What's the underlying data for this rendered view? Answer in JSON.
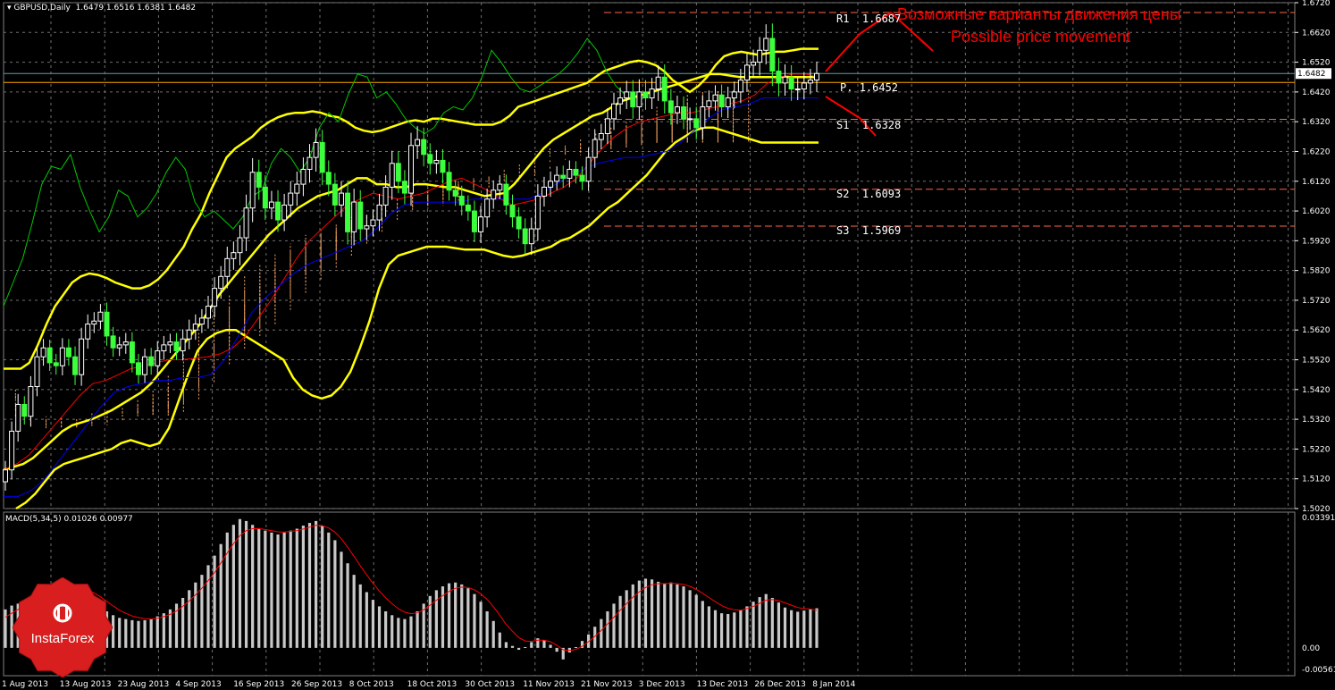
{
  "header": {
    "symbol": "GBPUSD,Daily",
    "ohlc": "1.6479 1.6516 1.6381 1.6482"
  },
  "chart_data": [
    {
      "type": "candlestick",
      "title": "GBPUSD,Daily",
      "ylim": [
        1.502,
        1.672
      ],
      "y_ticks": [
        "1.6720",
        "1.6620",
        "1.6520",
        "1.6420",
        "1.6320",
        "1.6220",
        "1.6120",
        "1.6020",
        "1.5920",
        "1.5820",
        "1.5720",
        "1.5620",
        "1.5520",
        "1.5420",
        "1.5320",
        "1.5220",
        "1.5120",
        "1.5020"
      ],
      "x_labels": [
        "1 Aug 2013",
        "13 Aug 2013",
        "23 Aug 2013",
        "4 Sep 2013",
        "16 Sep 2013",
        "26 Sep 2013",
        "8 Oct 2013",
        "18 Oct 2013",
        "30 Oct 2013",
        "11 Nov 2013",
        "21 Nov 2013",
        "3 Dec 2013",
        "13 Dec 2013",
        "26 Dec 2013",
        "8 Jan 2014"
      ],
      "last_price_label": "1.6482",
      "close": [
        1.515,
        1.528,
        1.537,
        1.533,
        1.543,
        1.553,
        1.556,
        1.551,
        1.55,
        1.556,
        1.553,
        1.547,
        1.559,
        1.564,
        1.565,
        1.568,
        1.56,
        1.556,
        1.557,
        1.558,
        1.551,
        1.547,
        1.553,
        1.55,
        1.555,
        1.557,
        1.558,
        1.555,
        1.559,
        1.562,
        1.564,
        1.566,
        1.57,
        1.576,
        1.58,
        1.586,
        1.588,
        1.593,
        1.603,
        1.615,
        1.61,
        1.603,
        1.605,
        1.599,
        1.604,
        1.608,
        1.611,
        1.616,
        1.62,
        1.625,
        1.615,
        1.611,
        1.604,
        1.608,
        1.595,
        1.605,
        1.596,
        1.597,
        1.599,
        1.604,
        1.61,
        1.618,
        1.612,
        1.608,
        1.624,
        1.626,
        1.621,
        1.618,
        1.619,
        1.615,
        1.609,
        1.607,
        1.604,
        1.602,
        1.595,
        1.6,
        1.606,
        1.609,
        1.611,
        1.604,
        1.6,
        1.596,
        1.591,
        1.596,
        1.607,
        1.61,
        1.612,
        1.614,
        1.613,
        1.616,
        1.614,
        1.612,
        1.62,
        1.626,
        1.628,
        1.633,
        1.638,
        1.64,
        1.642,
        1.637,
        1.642,
        1.64,
        1.643,
        1.647,
        1.639,
        1.635,
        1.637,
        1.633,
        1.633,
        1.63,
        1.637,
        1.639,
        1.641,
        1.637,
        1.64,
        1.642,
        1.646,
        1.651,
        1.652,
        1.656,
        1.66,
        1.649,
        1.645,
        1.647,
        1.643,
        1.643,
        1.645,
        1.646,
        1.6482
      ],
      "spread": [
        0.006,
        0.0065,
        0.007,
        0.0055,
        0.007,
        0.0065,
        0.006,
        0.0055,
        0.006,
        0.0065,
        0.006,
        0.007,
        0.0075,
        0.0065,
        0.006,
        0.0055,
        0.0065,
        0.006,
        0.0055,
        0.006,
        0.0065,
        0.006,
        0.0055,
        0.006,
        0.0065,
        0.006,
        0.0055,
        0.006,
        0.0065,
        0.007,
        0.0065,
        0.006,
        0.007,
        0.0075,
        0.007,
        0.008,
        0.0075,
        0.0085,
        0.009,
        0.0095,
        0.0085,
        0.008,
        0.0075,
        0.008,
        0.0075,
        0.008,
        0.0085,
        0.008,
        0.009,
        0.0095,
        0.0085,
        0.008,
        0.0075,
        0.008,
        0.0085,
        0.009,
        0.008,
        0.0075,
        0.007,
        0.0075,
        0.008,
        0.0085,
        0.008,
        0.0075,
        0.0085,
        0.009,
        0.008,
        0.0075,
        0.007,
        0.0075,
        0.007,
        0.0065,
        0.007,
        0.0065,
        0.007,
        0.0075,
        0.007,
        0.0065,
        0.006,
        0.0065,
        0.007,
        0.0065,
        0.007,
        0.0075,
        0.008,
        0.007,
        0.0065,
        0.006,
        0.0065,
        0.006,
        0.0055,
        0.006,
        0.0065,
        0.007,
        0.0065,
        0.007,
        0.0075,
        0.007,
        0.0075,
        0.008,
        0.0085,
        0.008,
        0.0075,
        0.008,
        0.0085,
        0.008,
        0.0075,
        0.007,
        0.0075,
        0.008,
        0.0075,
        0.007,
        0.0065,
        0.007,
        0.0075,
        0.007,
        0.0075,
        0.008,
        0.0085,
        0.009,
        0.0095,
        0.01,
        0.009,
        0.0085,
        0.008,
        0.0075,
        0.007,
        0.0075,
        0.008
      ],
      "open": 1.511,
      "bollinger_upper": [
        1.549,
        1.549,
        1.549,
        1.551,
        1.557,
        1.564,
        1.57,
        1.574,
        1.578,
        1.58,
        1.581,
        1.5805,
        1.5795,
        1.578,
        1.577,
        1.576,
        1.576,
        1.577,
        1.579,
        1.582,
        1.586,
        1.59,
        1.596,
        1.601,
        1.608,
        1.614,
        1.62,
        1.623,
        1.625,
        1.627,
        1.63,
        1.632,
        1.6335,
        1.6345,
        1.635,
        1.635,
        1.6355,
        1.635,
        1.634,
        1.6335,
        1.632,
        1.63,
        1.629,
        1.6285,
        1.629,
        1.63,
        1.631,
        1.632,
        1.6325,
        1.632,
        1.633,
        1.633,
        1.6325,
        1.632,
        1.6315,
        1.631,
        1.631,
        1.631,
        1.632,
        1.634,
        1.637,
        1.638,
        1.639,
        1.64,
        1.641,
        1.642,
        1.643,
        1.644,
        1.645,
        1.647,
        1.649,
        1.65,
        1.651,
        1.652,
        1.6525,
        1.652,
        1.651,
        1.649,
        1.646,
        1.644,
        1.642,
        1.644,
        1.647,
        1.651,
        1.654,
        1.655,
        1.6555,
        1.655,
        1.6545,
        1.655,
        1.6555,
        1.6555,
        1.656,
        1.6565,
        1.6565,
        1.6565
      ],
      "bollinger_mid": [
        1.515,
        1.516,
        1.517,
        1.519,
        1.522,
        1.525,
        1.528,
        1.53,
        1.531,
        1.532,
        1.5335,
        1.535,
        1.537,
        1.539,
        1.541,
        1.544,
        1.548,
        1.552,
        1.556,
        1.56,
        1.564,
        1.569,
        1.574,
        1.578,
        1.582,
        1.586,
        1.59,
        1.594,
        1.597,
        1.6,
        1.603,
        1.605,
        1.607,
        1.608,
        1.609,
        1.611,
        1.613,
        1.613,
        1.611,
        1.611,
        1.61,
        1.61,
        1.611,
        1.611,
        1.6105,
        1.61,
        1.61,
        1.609,
        1.608,
        1.607,
        1.6075,
        1.608,
        1.611,
        1.615,
        1.619,
        1.623,
        1.626,
        1.628,
        1.63,
        1.632,
        1.634,
        1.635,
        1.637,
        1.639,
        1.64,
        1.641,
        1.642,
        1.643,
        1.644,
        1.645,
        1.646,
        1.647,
        1.648,
        1.648,
        1.6475,
        1.647,
        1.647,
        1.647,
        1.647,
        1.647,
        1.647,
        1.647,
        1.647,
        1.647
      ],
      "bollinger_lower": [
        1.502,
        1.504,
        1.507,
        1.511,
        1.515,
        1.517,
        1.518,
        1.519,
        1.52,
        1.521,
        1.522,
        1.524,
        1.525,
        1.524,
        1.523,
        1.524,
        1.529,
        1.538,
        1.547,
        1.555,
        1.559,
        1.561,
        1.562,
        1.562,
        1.56,
        1.558,
        1.556,
        1.554,
        1.552,
        1.546,
        1.542,
        1.54,
        1.539,
        1.54,
        1.543,
        1.548,
        1.556,
        1.565,
        1.576,
        1.584,
        1.587,
        1.588,
        1.589,
        1.59,
        1.59,
        1.59,
        1.5895,
        1.589,
        1.589,
        1.589,
        1.588,
        1.587,
        1.5865,
        1.587,
        1.588,
        1.589,
        1.59,
        1.592,
        1.593,
        1.595,
        1.597,
        1.6,
        1.603,
        1.605,
        1.608,
        1.611,
        1.614,
        1.618,
        1.622,
        1.625,
        1.627,
        1.629,
        1.63,
        1.63,
        1.629,
        1.628,
        1.627,
        1.626,
        1.625,
        1.625,
        1.625,
        1.625,
        1.625,
        1.625,
        1.625
      ],
      "tenkan": [
        1.515,
        1.517,
        1.52,
        1.525,
        1.53,
        1.535,
        1.54,
        1.544,
        1.545,
        1.547,
        1.549,
        1.55,
        1.551,
        1.552,
        1.552,
        1.5525,
        1.553,
        1.554,
        1.556,
        1.56,
        1.566,
        1.572,
        1.579,
        1.586,
        1.592,
        1.596,
        1.6,
        1.604,
        1.606,
        1.608,
        1.607,
        1.606,
        1.607,
        1.608,
        1.61,
        1.612,
        1.613,
        1.611,
        1.609,
        1.606,
        1.604,
        1.605,
        1.606,
        1.608,
        1.61,
        1.613,
        1.618,
        1.623,
        1.627,
        1.63,
        1.632,
        1.633,
        1.634,
        1.635,
        1.635,
        1.636,
        1.637,
        1.638,
        1.639,
        1.641,
        1.645,
        1.647,
        1.648,
        1.648,
        1.647
      ],
      "kijun": [
        1.506,
        1.506,
        1.508,
        1.512,
        1.518,
        1.524,
        1.53,
        1.536,
        1.541,
        1.543,
        1.544,
        1.545,
        1.545,
        1.546,
        1.546,
        1.547,
        1.552,
        1.56,
        1.568,
        1.573,
        1.577,
        1.581,
        1.584,
        1.586,
        1.588,
        1.59,
        1.592,
        1.596,
        1.601,
        1.604,
        1.605,
        1.605,
        1.605,
        1.605,
        1.606,
        1.606,
        1.606,
        1.606,
        1.606,
        1.608,
        1.611,
        1.614,
        1.616,
        1.618,
        1.619,
        1.62,
        1.62,
        1.621,
        1.622,
        1.625,
        1.629,
        1.633,
        1.636,
        1.637,
        1.638,
        1.64,
        1.64,
        1.64,
        1.64,
        1.64
      ],
      "chikou": [
        1.57,
        1.578,
        1.586,
        1.598,
        1.611,
        1.617,
        1.616,
        1.621,
        1.61,
        1.602,
        1.595,
        1.6,
        1.609,
        1.607,
        1.6,
        1.603,
        1.608,
        1.615,
        1.62,
        1.616,
        1.605,
        1.6,
        1.602,
        1.599,
        1.596,
        1.6,
        1.607,
        1.609,
        1.618,
        1.623,
        1.62,
        1.615,
        1.62,
        1.63,
        1.635,
        1.632,
        1.641,
        1.648,
        1.647,
        1.64,
        1.642,
        1.638,
        1.633,
        1.63,
        1.628,
        1.63,
        1.635,
        1.637,
        1.636,
        1.64,
        1.647,
        1.656,
        1.652,
        1.647,
        1.643,
        1.642,
        1.644,
        1.646,
        1.648,
        1.651,
        1.655,
        1.66,
        1.656,
        1.649,
        1.644,
        1.641
      ],
      "cloud_a": [
        1.541,
        1.542,
        1.542,
        1.538,
        1.533,
        1.53,
        1.529,
        1.53,
        1.532,
        1.534,
        1.535,
        1.534,
        1.533,
        1.535,
        1.54,
        1.546,
        1.552,
        1.557,
        1.561,
        1.565,
        1.57,
        1.576,
        1.58,
        1.584,
        1.588,
        1.592,
        1.596,
        1.6,
        1.604,
        1.606,
        1.608,
        1.61,
        1.611,
        1.612,
        1.613,
        1.613,
        1.614,
        1.617,
        1.62,
        1.623,
        1.624,
        1.626,
        1.628,
        1.63,
        1.632,
        1.634,
        1.637,
        1.639,
        1.641,
        1.642,
        1.643
      ],
      "cloud_b": [
        1.541,
        1.54,
        1.538,
        1.535,
        1.534,
        1.532,
        1.531,
        1.53,
        1.53,
        1.532,
        1.534,
        1.536,
        1.539,
        1.542,
        1.547,
        1.554,
        1.561,
        1.568,
        1.574,
        1.58,
        1.584,
        1.588,
        1.591,
        1.594,
        1.596,
        1.598,
        1.6,
        1.601,
        1.602,
        1.603,
        1.604,
        1.606,
        1.608,
        1.61,
        1.612,
        1.614,
        1.616,
        1.618,
        1.62,
        1.621,
        1.622,
        1.623,
        1.623,
        1.624,
        1.625,
        1.625,
        1.625,
        1.625,
        1.625,
        1.625,
        1.625
      ],
      "pivots": [
        {
          "label": "R1",
          "value": "1.6687",
          "num": 1.6687
        },
        {
          "label": "P",
          "value": "1.6452",
          "num": 1.6452
        },
        {
          "label": "S1",
          "value": "1.6328",
          "num": 1.6328
        },
        {
          "label": "S2",
          "value": "1.6093",
          "num": 1.6093
        },
        {
          "label": "S3",
          "value": "1.5969",
          "num": 1.5969
        }
      ]
    },
    {
      "type": "bar",
      "title": "MACD(5,34,5) 0.01026 0.00977",
      "ylim": [
        -0.00561,
        0.03391
      ],
      "y_ticks": [
        "0.03391",
        "0.00",
        "-0.00561"
      ],
      "histogram": [
        0.01,
        0.011,
        0.0115,
        0.0125,
        0.0135,
        0.015,
        0.016,
        0.0165,
        0.017,
        0.0172,
        0.0168,
        0.016,
        0.015,
        0.014,
        0.0125,
        0.011,
        0.0095,
        0.0085,
        0.0078,
        0.0075,
        0.0072,
        0.007,
        0.0072,
        0.0075,
        0.0082,
        0.009,
        0.01,
        0.0115,
        0.013,
        0.015,
        0.017,
        0.019,
        0.0215,
        0.024,
        0.027,
        0.03,
        0.032,
        0.0335,
        0.033,
        0.032,
        0.031,
        0.0305,
        0.03,
        0.0295,
        0.03,
        0.0305,
        0.031,
        0.0318,
        0.0325,
        0.033,
        0.0318,
        0.03,
        0.028,
        0.025,
        0.022,
        0.019,
        0.0165,
        0.0145,
        0.0125,
        0.0108,
        0.0095,
        0.0085,
        0.0078,
        0.0075,
        0.0082,
        0.0095,
        0.0115,
        0.0135,
        0.015,
        0.016,
        0.0168,
        0.017,
        0.0165,
        0.0155,
        0.014,
        0.012,
        0.0095,
        0.007,
        0.004,
        0.0015,
        0.0005,
        -0.0005,
        0.0002,
        0.0015,
        0.0025,
        0.002,
        0.0008,
        -0.001,
        -0.003,
        -0.0012,
        0.0002,
        0.0018,
        0.0035,
        0.0055,
        0.0075,
        0.0095,
        0.0115,
        0.0135,
        0.015,
        0.0165,
        0.0175,
        0.018,
        0.0178,
        0.0172,
        0.0168,
        0.017,
        0.0165,
        0.016,
        0.015,
        0.0138,
        0.0122,
        0.0108,
        0.0098,
        0.009,
        0.0088,
        0.0092,
        0.0098,
        0.0108,
        0.012,
        0.0132,
        0.014,
        0.013,
        0.0118,
        0.0105,
        0.0098,
        0.0094,
        0.0097,
        0.01,
        0.0103
      ],
      "signal": [
        0.008,
        0.009,
        0.01,
        0.011,
        0.012,
        0.013,
        0.014,
        0.015,
        0.0155,
        0.016,
        0.0163,
        0.0162,
        0.0158,
        0.0152,
        0.0143,
        0.0133,
        0.0121,
        0.0109,
        0.0098,
        0.009,
        0.0083,
        0.0079,
        0.0076,
        0.0075,
        0.0077,
        0.0081,
        0.0087,
        0.0096,
        0.0108,
        0.0122,
        0.0138,
        0.0155,
        0.0175,
        0.0196,
        0.0221,
        0.0247,
        0.0271,
        0.0292,
        0.0305,
        0.031,
        0.031,
        0.0308,
        0.0305,
        0.0302,
        0.0301,
        0.0303,
        0.0305,
        0.0309,
        0.0314,
        0.0319,
        0.0318,
        0.0312,
        0.0301,
        0.0284,
        0.0262,
        0.0238,
        0.0213,
        0.019,
        0.0168,
        0.0148,
        0.013,
        0.0115,
        0.0102,
        0.0093,
        0.0089,
        0.0091,
        0.0099,
        0.0111,
        0.0124,
        0.0136,
        0.0147,
        0.0155,
        0.0158,
        0.0157,
        0.0151,
        0.0141,
        0.0126,
        0.0107,
        0.0085,
        0.0061,
        0.0043,
        0.0027,
        0.0018,
        0.0017,
        0.002,
        0.002,
        0.0016,
        0.0007,
        -0.0005,
        -0.0007,
        -0.0004,
        0.0004,
        0.0016,
        0.003,
        0.0045,
        0.0062,
        0.008,
        0.0098,
        0.0115,
        0.0132,
        0.0146,
        0.0157,
        0.0164,
        0.0167,
        0.0167,
        0.0168,
        0.0167,
        0.0165,
        0.016,
        0.0152,
        0.0142,
        0.0131,
        0.012,
        0.011,
        0.0103,
        0.0099,
        0.0098,
        0.0102,
        0.0108,
        0.0116,
        0.0124,
        0.0126,
        0.0123,
        0.0117,
        0.0111,
        0.0105,
        0.0102,
        0.0101,
        0.0098
      ]
    }
  ],
  "annotation": {
    "ru": "Возможные варианты движения цены",
    "en": "Possible price movement"
  },
  "logo": {
    "text": "InstaForex",
    "icon": "instaforex-logo-icon"
  },
  "colors": {
    "bull": "#ffffff",
    "bear": "#3cff3c",
    "bollinger": "#ffff00",
    "tenkan": "#ff0000",
    "kijun": "#0000ff",
    "chikou": "#00c800",
    "cloud": "#f4a460",
    "pivot_line": "#ff6347",
    "annotation": "#ff0000",
    "grid": "#707070"
  }
}
